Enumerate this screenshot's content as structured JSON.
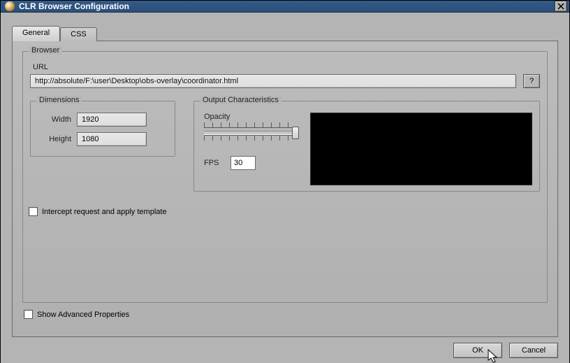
{
  "window": {
    "title": "CLR Browser Configuration"
  },
  "tabs": {
    "general": "General",
    "css": "CSS"
  },
  "group_browser": "Browser",
  "url": {
    "label": "URL",
    "value": "http://absolute/F:\\user\\Desktop\\obs-overlay\\coordinator.html",
    "help_label": "?"
  },
  "dimensions": {
    "legend": "Dimensions",
    "width_label": "Width",
    "width_value": "1920",
    "height_label": "Height",
    "height_value": "1080"
  },
  "output": {
    "legend": "Output Characteristics",
    "opacity_label": "Opacity",
    "fps_label": "FPS",
    "fps_value": "30"
  },
  "intercept_label": "Intercept request and apply template",
  "advanced_label": "Show Advanced Properties",
  "buttons": {
    "ok": "OK",
    "cancel": "Cancel"
  }
}
